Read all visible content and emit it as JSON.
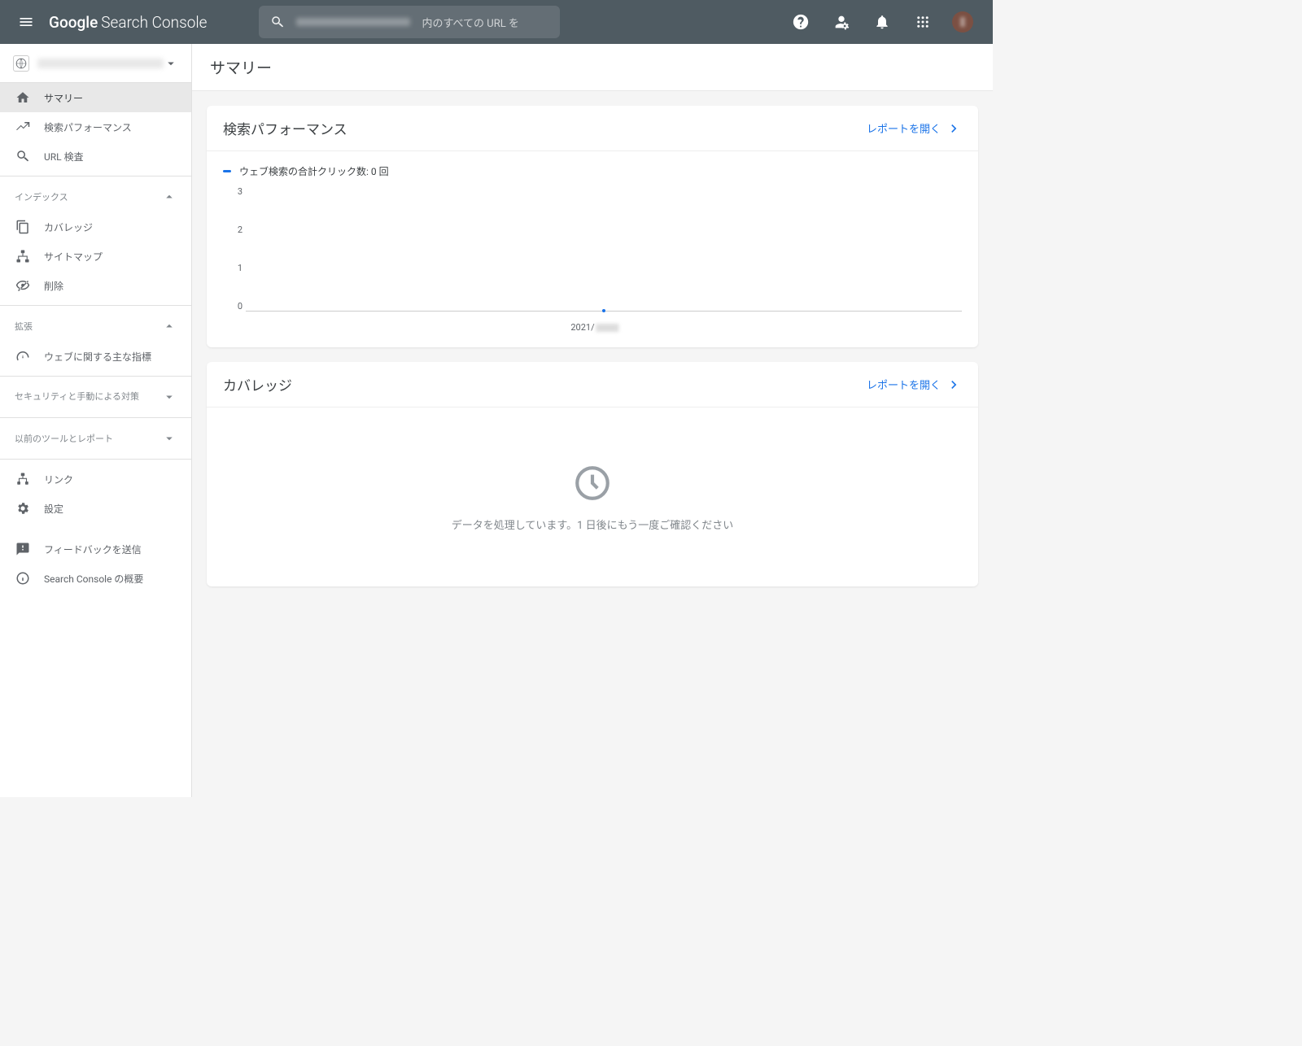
{
  "header": {
    "logo_google": "Google",
    "logo_app": "Search Console",
    "search_hint": "内のすべての URL を"
  },
  "sidebar": {
    "nav": {
      "summary": "サマリー",
      "performance": "検索パフォーマンス",
      "url_inspect": "URL 検査"
    },
    "section_index": "インデックス",
    "index": {
      "coverage": "カバレッジ",
      "sitemaps": "サイトマップ",
      "removals": "削除"
    },
    "section_enhance": "拡張",
    "enhance": {
      "cwv": "ウェブに関する主な指標"
    },
    "section_security": "セキュリティと手動による対策",
    "section_legacy": "以前のツールとレポート",
    "footer": {
      "links": "リンク",
      "settings": "設定",
      "feedback": "フィードバックを送信",
      "about": "Search Console の概要"
    }
  },
  "page": {
    "title": "サマリー"
  },
  "perf_card": {
    "title": "検索パフォーマンス",
    "open_report": "レポートを開く",
    "legend": "ウェブ検索の合計クリック数: 0 回"
  },
  "coverage_card": {
    "title": "カバレッジ",
    "open_report": "レポートを開く",
    "message": "データを処理しています。1 日後にもう一度ご確認ください"
  },
  "chart_data": {
    "type": "line",
    "title": "ウェブ検索の合計クリック数: 0 回",
    "xlabel": "",
    "ylabel": "",
    "y_ticks": [
      0,
      1,
      2,
      3
    ],
    "ylim": [
      0,
      3
    ],
    "x_tick_label": "2021/",
    "series": [
      {
        "name": "ウェブ検索の合計クリック数",
        "values": [
          0
        ]
      }
    ]
  }
}
